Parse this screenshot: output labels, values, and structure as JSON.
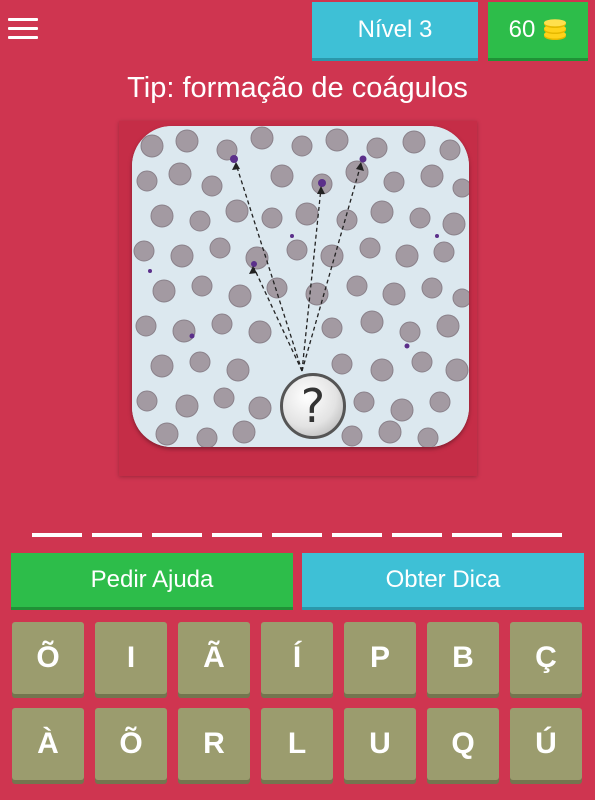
{
  "header": {
    "level_label": "Nível 3",
    "coins": "60",
    "coin_icon": "coin-stack-icon",
    "menu_icon": "hamburger-menu-icon"
  },
  "tip": {
    "text": "Tip: formação de coágulos"
  },
  "image": {
    "description_icon": "question-mark-icon",
    "badge_text": "?"
  },
  "answer": {
    "slot_count": 9
  },
  "buttons": {
    "help_label": "Pedir Ajuda",
    "hint_label": "Obter Dica"
  },
  "keyboard": {
    "keys": [
      "Õ",
      "I",
      "Ã",
      "Í",
      "P",
      "B",
      "Ç",
      "À",
      "Õ",
      "R",
      "L",
      "U",
      "Q",
      "Ú"
    ]
  },
  "colors": {
    "background": "#cf3550",
    "green": "#2dbd4a",
    "cyan": "#3ec0d6",
    "key": "#9b9c6e"
  }
}
